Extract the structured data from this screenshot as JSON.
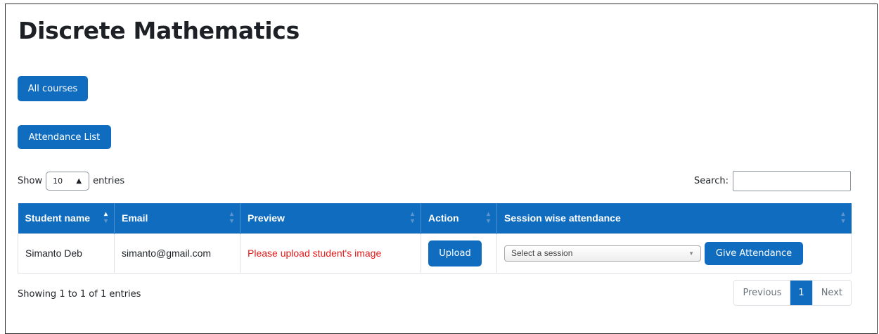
{
  "page": {
    "title": "Discrete Mathematics"
  },
  "buttons": {
    "all_courses": "All courses",
    "attendance_list": "Attendance List"
  },
  "length_control": {
    "show": "Show",
    "value": "10",
    "entries": "entries"
  },
  "search": {
    "label": "Search:",
    "value": ""
  },
  "table": {
    "columns": [
      "Student name",
      "Email",
      "Preview",
      "Action",
      "Session wise attendance"
    ],
    "sorted_column": "Student name",
    "rows": [
      {
        "name": "Simanto Deb",
        "email": "simanto@gmail.com",
        "preview": "Please upload student's image",
        "action": "Upload",
        "session_placeholder": "Select a session",
        "give_attendance": "Give Attendance"
      }
    ]
  },
  "info": "Showing 1 to 1 of 1 entries",
  "pagination": {
    "previous": "Previous",
    "current": "1",
    "next": "Next"
  },
  "colors": {
    "primary": "#0f6cbf",
    "warning_text": "#e01a1a"
  },
  "icons": {
    "sort": "sort-icon",
    "select_caret": "chevron-down-icon"
  }
}
